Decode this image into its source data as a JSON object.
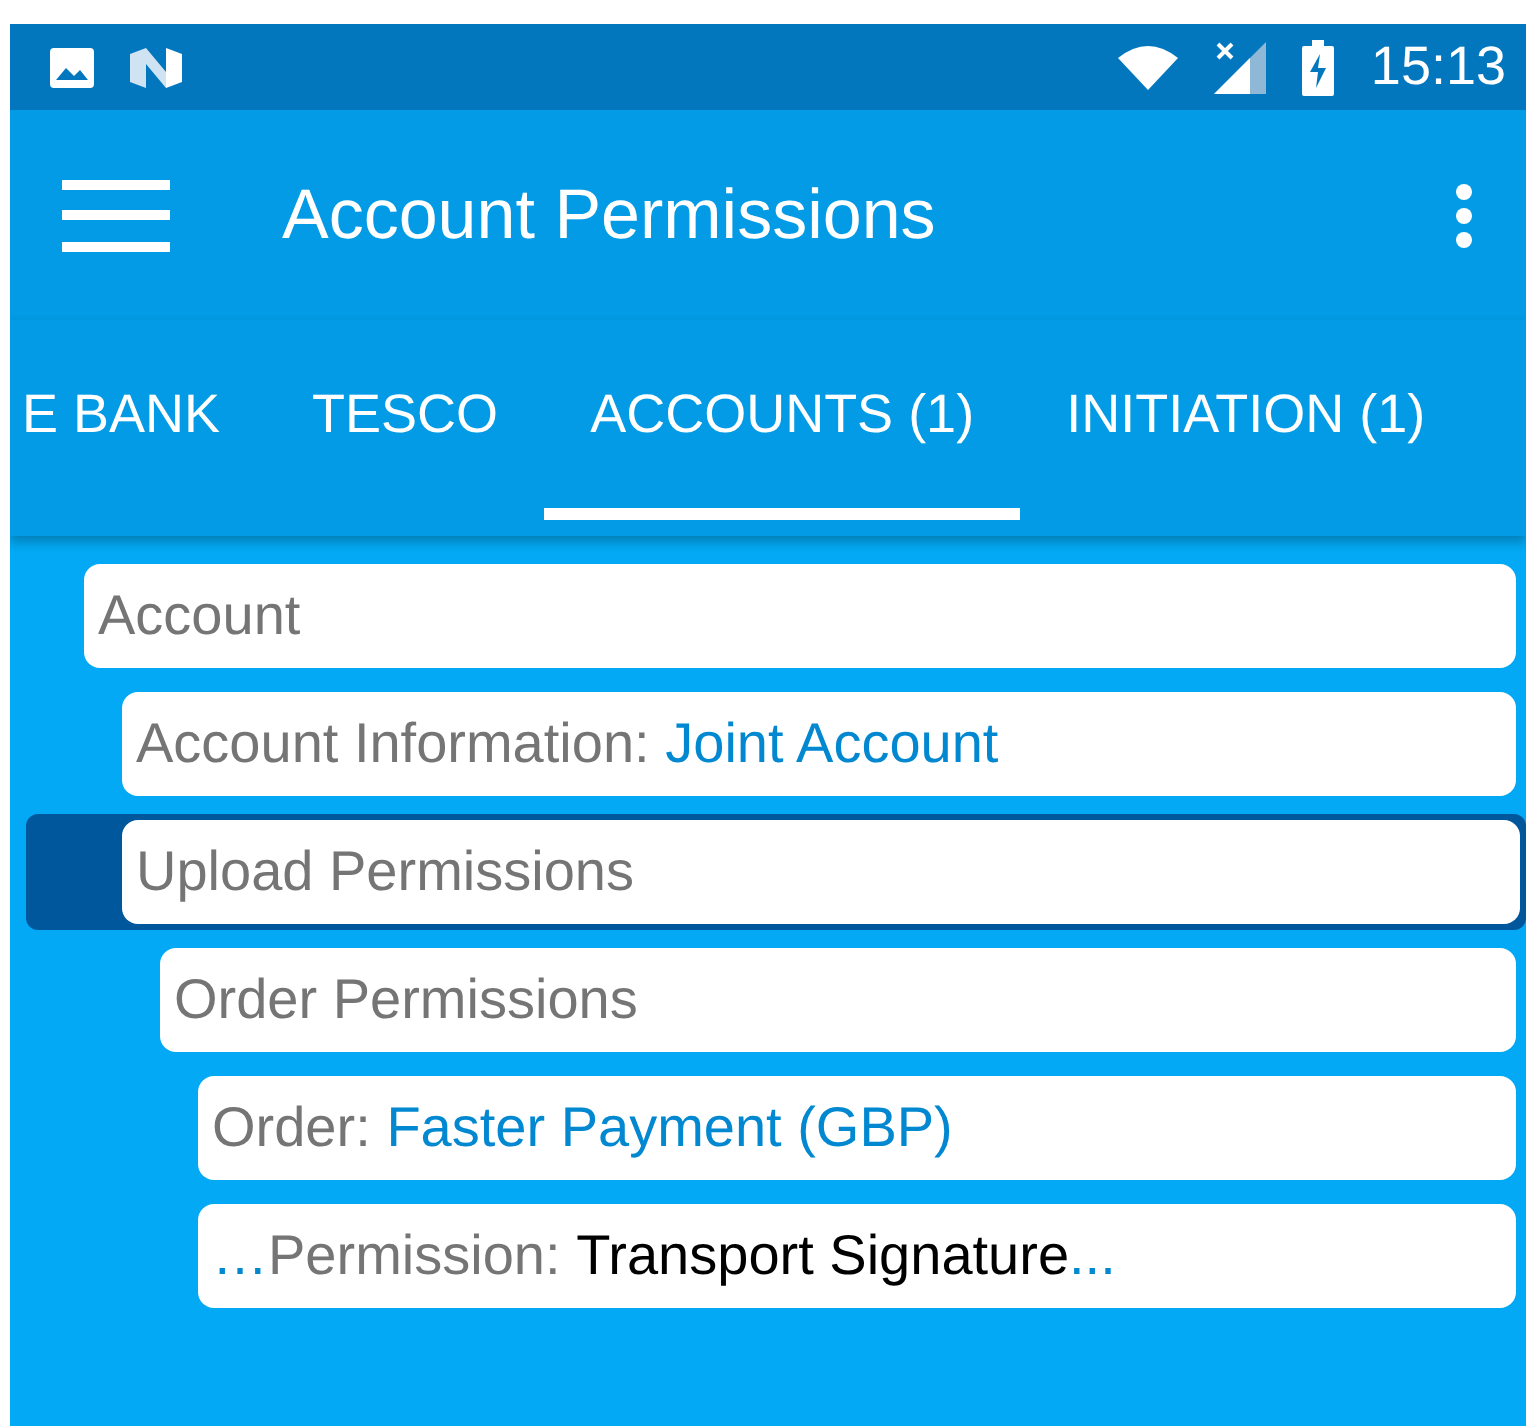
{
  "status_bar": {
    "time": "15:13"
  },
  "app_bar": {
    "title": "Account Permissions"
  },
  "tabs": [
    {
      "label": "E BANK",
      "selected": false
    },
    {
      "label": "TESCO",
      "selected": false
    },
    {
      "label": "ACCOUNTS (1)",
      "selected": true
    },
    {
      "label": "INITIATION (1)",
      "selected": false
    }
  ],
  "tree": [
    {
      "label": "Account",
      "selected": false,
      "children": [
        {
          "label": "Account Information:",
          "value": "Joint Account",
          "kind": "link",
          "selected": false
        },
        {
          "label": "Upload Permissions",
          "selected": true,
          "children": [
            {
              "label": "Order Permissions",
              "selected": false,
              "children": [
                {
                  "label": "Order:",
                  "value": "Faster Payment (GBP)",
                  "kind": "link",
                  "selected": false
                },
                {
                  "lead": "…",
                  "label": "Permission:",
                  "value": "Transport Signature",
                  "kind": "plain",
                  "trail": "...",
                  "selected": false
                }
              ]
            }
          ]
        }
      ]
    }
  ]
}
